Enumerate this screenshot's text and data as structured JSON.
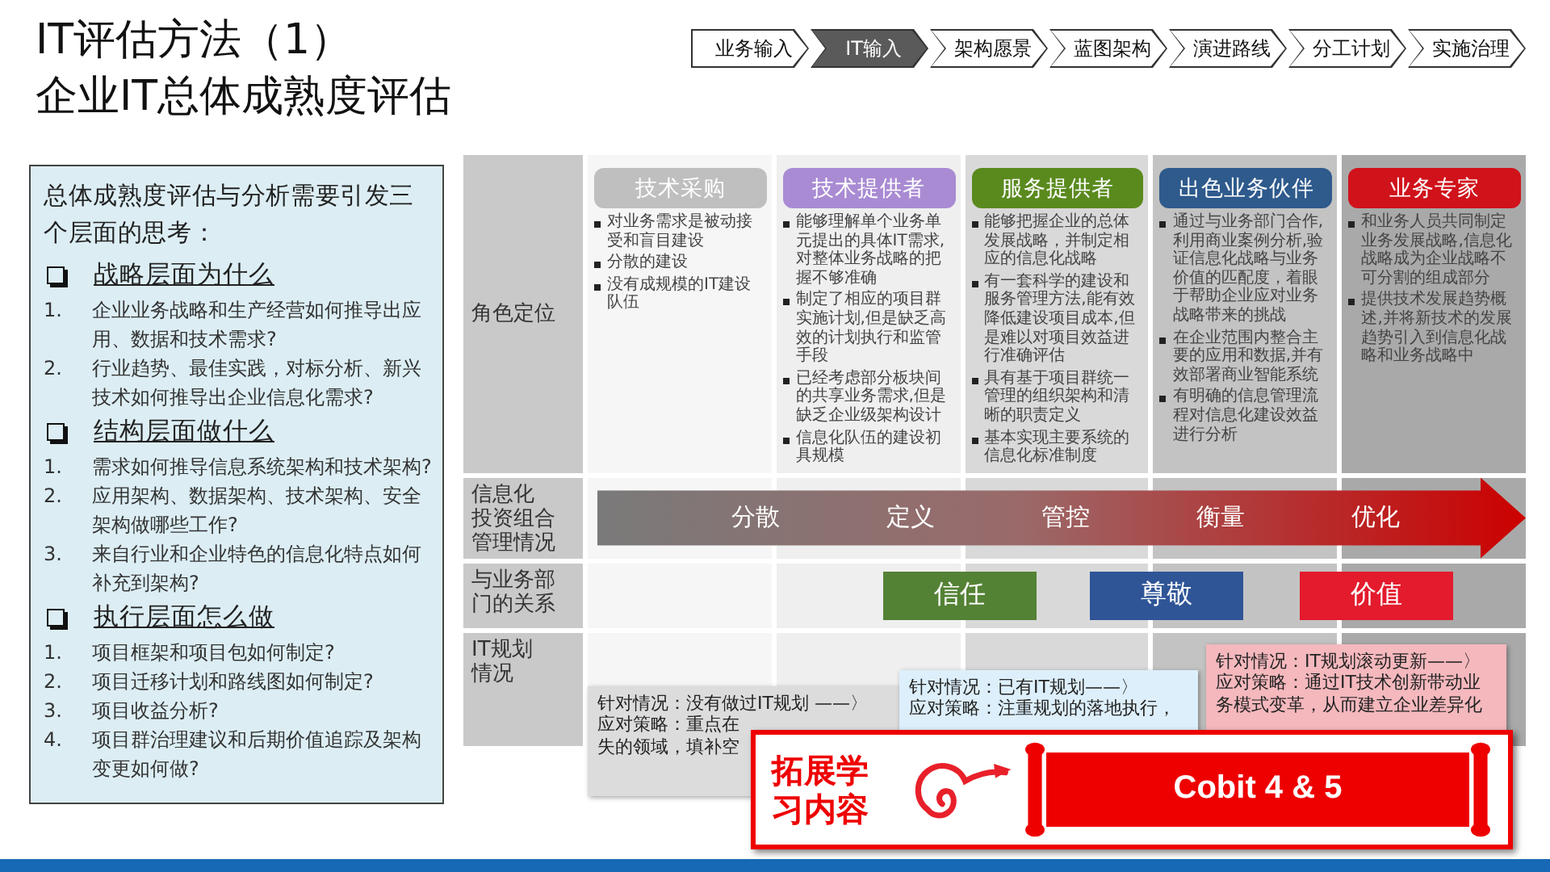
{
  "title": {
    "line_1": "IT评估方法（1）",
    "line_2": "企业IT总体成熟度评估"
  },
  "steps": [
    {
      "label": "业务输入",
      "selected": false
    },
    {
      "label": "IT输入",
      "selected": true
    },
    {
      "label": "架构愿景",
      "selected": false
    },
    {
      "label": "蓝图架构",
      "selected": false
    },
    {
      "label": "演进路线",
      "selected": false
    },
    {
      "label": "分工计划",
      "selected": false
    },
    {
      "label": "实施治理",
      "selected": false
    }
  ],
  "questions_panel": {
    "intro": "总体成熟度评估与分析需要引发三个层面的思考：",
    "sections": [
      {
        "heading": "战略层面为什么",
        "items": [
          {
            "number": "1.",
            "text": "企业业务战略和生产经营如何推导出应用、数据和技术需求?"
          },
          {
            "number": "2.",
            "text": "行业趋势、最佳实践，对标分析、新兴技术如何推导出企业信息化需求?"
          }
        ]
      },
      {
        "heading": "结构层面做什么",
        "items": [
          {
            "number": "1.",
            "text": "需求如何推导信息系统架构和技术架构?"
          },
          {
            "number": "2.",
            "text": "应用架构、数据架构、技术架构、安全架构做哪些工作?"
          },
          {
            "number": "3.",
            "text": "来自行业和企业特色的信息化特点如何补充到架构?"
          }
        ]
      },
      {
        "heading": "执行层面怎么做",
        "items": [
          {
            "number": "1.",
            "text": "项目框架和项目包如何制定?"
          },
          {
            "number": "2.",
            "text": "项目迁移计划和路线图如何制定?"
          },
          {
            "number": "3.",
            "text": "项目收益分析?"
          },
          {
            "number": "4.",
            "text": "项目群治理建议和后期价值追踪及架构变更如何做?"
          }
        ]
      }
    ]
  },
  "matrix": {
    "row_labels": [
      {
        "lines": [
          "角色定位"
        ]
      },
      {
        "lines": [
          "信息化",
          "投资组合",
          "管理情况"
        ]
      },
      {
        "lines": [
          "与业务部",
          "门的关系"
        ]
      },
      {
        "lines": [
          "IT规划",
          "情况"
        ]
      }
    ],
    "roles": [
      {
        "title": "技术采购",
        "color": "#bfbfbf",
        "points": [
          "对业务需求是被动接受和盲目建设",
          "分散的建设",
          "没有成规模的IT建设队伍"
        ]
      },
      {
        "title": "技术提供者",
        "color": "#a98bd3",
        "points": [
          "能够理解单个业务单元提出的具体IT需求,对整体业务战略的把握不够准确",
          "制定了相应的项目群实施计划,但是缺乏高效的计划执行和监管手段",
          "已经考虑部分板块间的共享业务需求,但是缺乏企业级架构设计",
          "信息化队伍的建设初具规模"
        ]
      },
      {
        "title": "服务提供者",
        "color": "#5a8a1e",
        "points": [
          "能够把握企业的总体发展战略，并制定相应的信息化战略",
          "有一套科学的建设和服务管理方法,能有效降低建设项目成本,但是难以对项目效益进行准确评估",
          "具有基于项目群统一管理的组织架构和清晰的职责定义",
          "基本实现主要系统的信息化标准制度"
        ]
      },
      {
        "title": "出色业务伙伴",
        "color": "#2e5a8c",
        "points": [
          "通过与业务部门合作,利用商业案例分析,验证信息化战略与业务价值的匹配度，着眼于帮助企业应对业务战略带来的挑战",
          "在企业范围内整合主要的应用和数据,并有效部署商业智能系统",
          "有明确的信息管理流程对信息化建设效益进行分析"
        ]
      },
      {
        "title": "业务专家",
        "color": "#d0121b",
        "points": [
          "和业务人员共同制定业务发展战略,信息化战略成为企业战略不可分割的组成部分",
          "提供技术发展趋势概述,并将新技术的发展趋势引入到信息化战略和业务战略中"
        ]
      }
    ],
    "portfolio_stages": [
      "分散",
      "定义",
      "管控",
      "衡量",
      "优化"
    ],
    "relations": [
      {
        "label": "信任",
        "color": "#548235"
      },
      {
        "label": "尊敬",
        "color": "#2f5597"
      },
      {
        "label": "价值",
        "color": "#e31b2d"
      }
    ],
    "planning_notes": [
      {
        "color": "#dcdcdc",
        "lines": [
          "针对情况：没有做过IT规划 ——〉",
          "应对策略：重点在",
          "失的领域，填补空"
        ]
      },
      {
        "color": "#ddeffb",
        "lines": [
          "针对情况：已有IT规划——〉",
          "应对策略：注重规划的落地执行，"
        ]
      },
      {
        "color": "#f4b8bd",
        "lines": [
          "针对情况：IT规划滚动更新——〉",
          "应对策略：通过IT技术创新带动业",
          "务模式变革，从而建立企业差异化"
        ]
      }
    ]
  },
  "promo": {
    "label": "拓展学习内容",
    "scroll_text": "Cobit 4 & 5"
  }
}
